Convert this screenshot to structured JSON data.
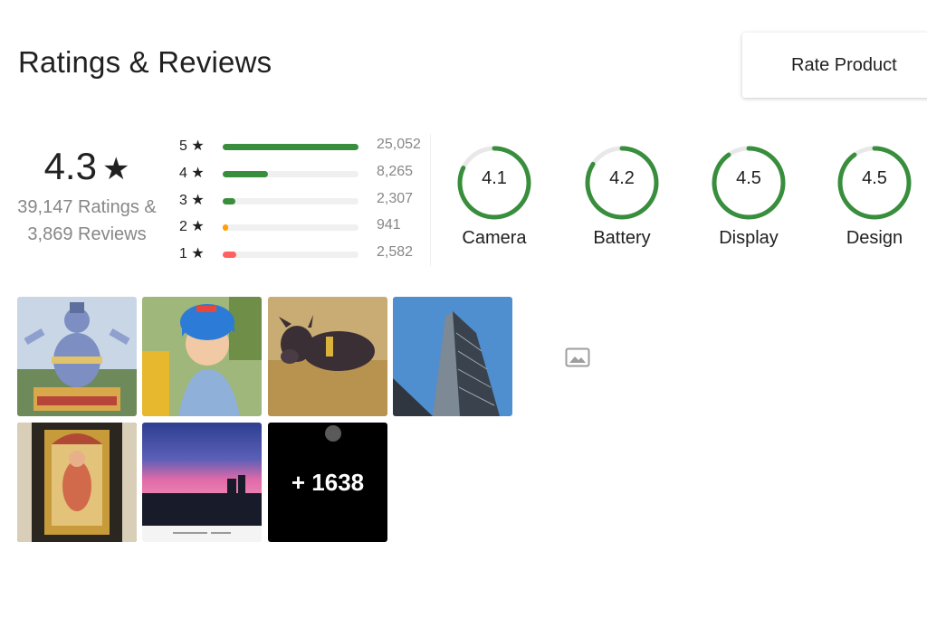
{
  "header": {
    "title": "Ratings & Reviews",
    "rate_button": "Rate Product"
  },
  "summary": {
    "average": "4.3",
    "star": "★",
    "ratings_count": "39,147 Ratings &",
    "reviews_count": "3,869 Reviews"
  },
  "distribution": [
    {
      "label": "5 ★",
      "count": "25,052",
      "fraction": 1.0,
      "color": "#388e3c"
    },
    {
      "label": "4 ★",
      "count": "8,265",
      "fraction": 0.33,
      "color": "#388e3c"
    },
    {
      "label": "3 ★",
      "count": "2,307",
      "fraction": 0.09,
      "color": "#388e3c"
    },
    {
      "label": "2 ★",
      "count": "941",
      "fraction": 0.04,
      "color": "#ff9f00"
    },
    {
      "label": "1 ★",
      "count": "2,582",
      "fraction": 0.1,
      "color": "#ff6161"
    }
  ],
  "aspects": [
    {
      "name": "Camera",
      "value": "4.1",
      "score": 4.1
    },
    {
      "name": "Battery",
      "value": "4.2",
      "score": 4.2
    },
    {
      "name": "Display",
      "value": "4.5",
      "score": 4.5
    },
    {
      "name": "Design",
      "value": "4.5",
      "score": 4.5
    }
  ],
  "accent_color": "#388e3c",
  "photos": {
    "thumbnails": [
      "statue-photo",
      "child-photo",
      "calf-photo",
      "building-photo",
      "shrine-photo",
      "sunset-photo"
    ],
    "more_label": "+ 1638",
    "icon": "image-icon"
  }
}
